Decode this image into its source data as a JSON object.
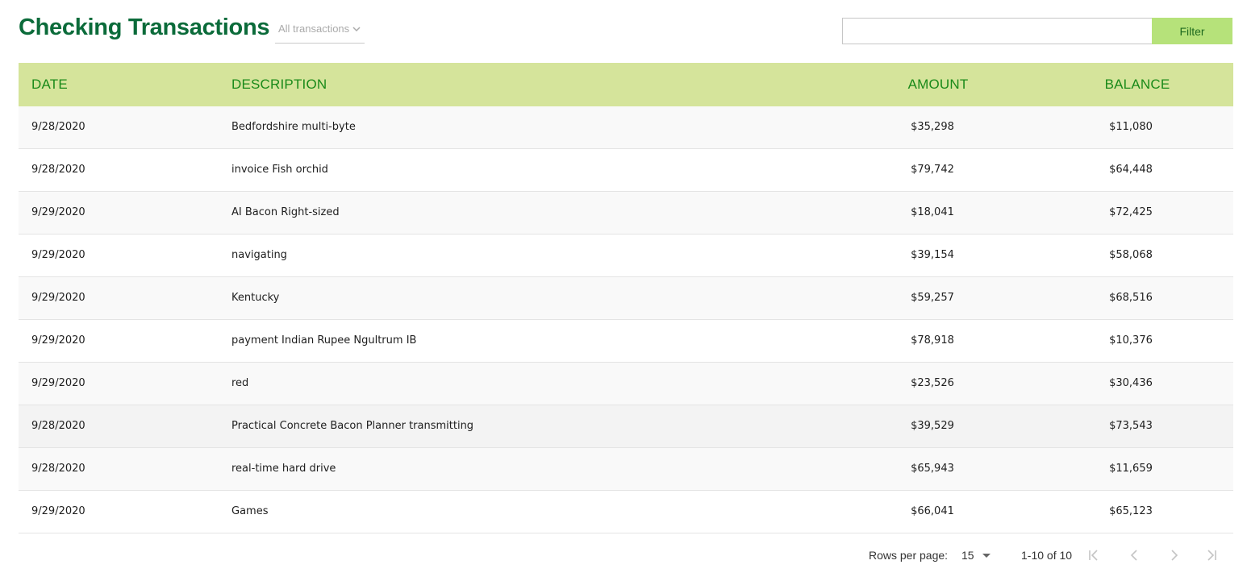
{
  "header": {
    "title": "Checking Transactions",
    "view_select": "All transactions",
    "search_value": "",
    "filter_label": "Filter"
  },
  "table": {
    "columns": {
      "date": "DATE",
      "description": "DESCRIPTION",
      "amount": "AMOUNT",
      "balance": "BALANCE"
    },
    "rows": [
      {
        "date": "9/28/2020",
        "description": "Bedfordshire multi-byte",
        "amount": "$35,298",
        "balance": "$11,080"
      },
      {
        "date": "9/28/2020",
        "description": "invoice Fish orchid",
        "amount": "$79,742",
        "balance": "$64,448"
      },
      {
        "date": "9/29/2020",
        "description": "AI Bacon Right-sized",
        "amount": "$18,041",
        "balance": "$72,425"
      },
      {
        "date": "9/29/2020",
        "description": "navigating",
        "amount": "$39,154",
        "balance": "$58,068"
      },
      {
        "date": "9/29/2020",
        "description": "Kentucky",
        "amount": "$59,257",
        "balance": "$68,516"
      },
      {
        "date": "9/29/2020",
        "description": "payment Indian Rupee Ngultrum IB",
        "amount": "$78,918",
        "balance": "$10,376"
      },
      {
        "date": "9/29/2020",
        "description": "red",
        "amount": "$23,526",
        "balance": "$30,436"
      },
      {
        "date": "9/28/2020",
        "description": "Practical Concrete Bacon Planner transmitting",
        "amount": "$39,529",
        "balance": "$73,543"
      },
      {
        "date": "9/28/2020",
        "description": "real-time hard drive",
        "amount": "$65,943",
        "balance": "$11,659"
      },
      {
        "date": "9/29/2020",
        "description": "Games",
        "amount": "$66,041",
        "balance": "$65,123"
      }
    ]
  },
  "pager": {
    "rows_per_page_label": "Rows per page:",
    "rows_per_page_value": "15",
    "range": "1-10 of 10"
  },
  "colors": {
    "title": "#0b6b3a",
    "header_bg": "#d5e49b",
    "header_text": "#1a8a1a",
    "filter_bg": "#b6e27a"
  },
  "icons": {
    "view_select": "chevron-down-icon",
    "rows_select": "caret-down-icon",
    "first": "first-page-icon",
    "prev": "chevron-left-icon",
    "next": "chevron-right-icon",
    "last": "last-page-icon"
  }
}
